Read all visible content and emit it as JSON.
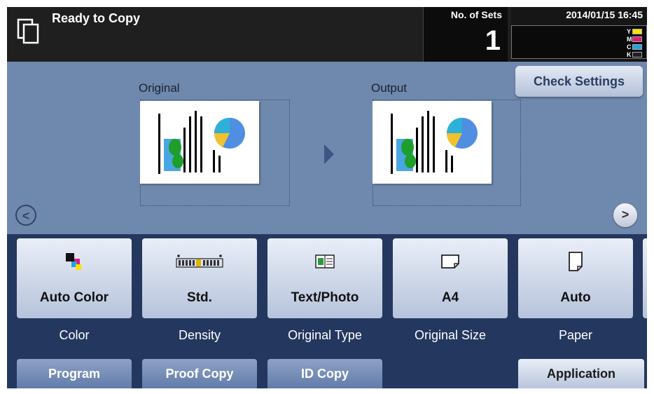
{
  "header": {
    "status": "Ready to Copy",
    "copy_icon": "copy-mode-icon",
    "sets_label": "No. of Sets",
    "sets_value": "1",
    "datetime": "2014/01/15 16:45",
    "toner": [
      {
        "label": "Y",
        "color": "#ffe000"
      },
      {
        "label": "M",
        "color": "#e5197e"
      },
      {
        "label": "C",
        "color": "#1fa3e0"
      },
      {
        "label": "K",
        "color": "#202020"
      }
    ]
  },
  "check_settings_label": "Check Settings",
  "preview": {
    "original_label": "Original",
    "output_label": "Output"
  },
  "nav": {
    "prev": "<",
    "next": ">"
  },
  "functions": [
    {
      "name": "color",
      "value": "Auto Color",
      "label": "Color",
      "icon": "auto-color-icon"
    },
    {
      "name": "density",
      "value": "Std.",
      "label": "Density",
      "icon": "density-scale-icon"
    },
    {
      "name": "original-type",
      "value": "Text/Photo",
      "label": "Original Type",
      "icon": "text-photo-icon"
    },
    {
      "name": "original-size",
      "value": "A4",
      "label": "Original Size",
      "icon": "original-size-icon"
    },
    {
      "name": "paper",
      "value": "Auto",
      "label": "Paper",
      "icon": "paper-icon"
    }
  ],
  "bottom_buttons": {
    "program": "Program",
    "proof_copy": "Proof Copy",
    "id_copy": "ID Copy",
    "application": "Application"
  },
  "colors": {
    "panel_bg": "#6f88ad",
    "header_bg": "#1f1f1f",
    "function_bar_bg": "#24375f",
    "accent_text": "#2c3e63"
  }
}
